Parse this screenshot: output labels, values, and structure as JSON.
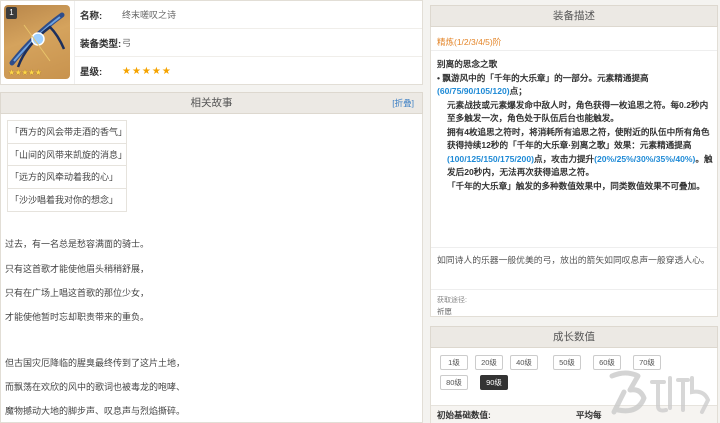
{
  "weapon": {
    "level_badge": "1",
    "img_stars": "★★★★★",
    "name_label": "名称:",
    "name_value": "终末嗟叹之诗",
    "type_label": "装备类型:",
    "type_value": "弓",
    "rarity_label": "星级:",
    "rarity_stars": "★★★★★"
  },
  "story": {
    "title": "相关故事",
    "fold": "[折叠]",
    "verses": [
      "「西方的风会带走酒的香气」",
      "「山间的风带来凯旋的消息」",
      "「远方的风牵动着我的心」",
      "「沙沙唱着我对你的想念」"
    ],
    "paragraphs": [
      "过去，有一名总是愁容满面的骑士。",
      "只有这首歌才能使他眉头稍稍舒展，",
      "只有在广场上唱这首歌的那位少女，",
      "才能使他暂时忘却职责带来的重负。",
      "但古国灾厄降临的腥臭最终传到了这片土地，",
      "而飘荡在欢欣的风中的歌词也被毒龙的咆哮、",
      "魔物撼动大地的脚步声、叹息声与烈焰撕碎。"
    ]
  },
  "description": {
    "title": "装备描述",
    "refine": "精炼(1/2/3/4/5)阶",
    "skill_name": "别离的思念之歌",
    "p1_a": "• 飘游风中的「千年的大乐章」的一部分。元素精通提高",
    "p1_hl": "(60/75/90/105/120)",
    "p1_b": "点；",
    "p2": "元素战技或元素爆发命中敌人时，角色获得一枚追思之符。每0.2秒内至多触发一次，角色处于队伍后台也能触发。",
    "p3_a": "拥有4枚追思之符时，将消耗所有追思之符，使附近的队伍中所有角色获得持续12秒的「千年的大乐章·别离之歌」效果：元素精通提高",
    "p3_hl1": "(100/125/150/175/200)",
    "p3_b": "点，攻击力提升",
    "p3_hl2": "(20%/25%/30%/35%/40%)",
    "p3_c": "。触发后20秒内，无法再次获得追思之符。",
    "p4": "「千年的大乐章」触发的多种数值效果中，同类数值效果不可叠加。",
    "flavor": "如同诗人的乐器一般优美的弓，放出的箭矢如同叹息声一般穿透人心。",
    "source_label": "获取途径:",
    "source_value": "祈愿"
  },
  "growth": {
    "title": "成长数值",
    "levels": [
      "1级",
      "20级",
      "40级",
      "50级",
      "60级",
      "70级",
      "80级",
      "90级"
    ],
    "active_level": "90级",
    "col1": "初始基础数值:",
    "col2": "平均每"
  },
  "colors": {
    "accent_blue": "#1e8ad6",
    "refine_orange": "#e4862a",
    "star_gold": "#f5a300"
  }
}
